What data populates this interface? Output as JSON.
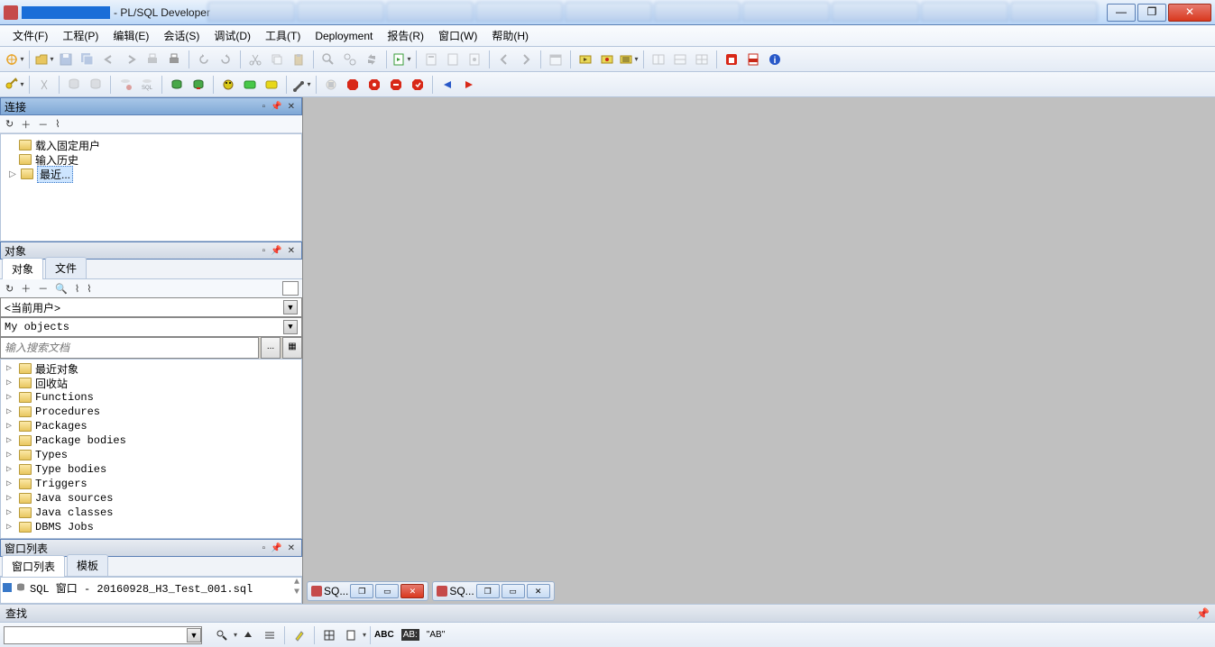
{
  "title": "- PL/SQL Developer",
  "menu": [
    "文件(F)",
    "工程(P)",
    "编辑(E)",
    "会话(S)",
    "调试(D)",
    "工具(T)",
    "Deployment",
    "报告(R)",
    "窗口(W)",
    "帮助(H)"
  ],
  "panels": {
    "connections": {
      "title": "连接"
    },
    "objects": {
      "title": "对象"
    },
    "winlist": {
      "title": "窗口列表"
    }
  },
  "conn_tree": [
    {
      "label": "载入固定用户",
      "exp": false
    },
    {
      "label": "输入历史",
      "exp": false
    },
    {
      "label": "最近...",
      "exp": true,
      "selected": true
    }
  ],
  "obj_tabs": [
    "对象",
    "文件"
  ],
  "obj_user": "<当前用户>",
  "obj_filter": "My objects",
  "obj_search_placeholder": "输入搜索文档",
  "obj_tree": [
    "最近对象",
    "回收站",
    "Functions",
    "Procedures",
    "Packages",
    "Package bodies",
    "Types",
    "Type bodies",
    "Triggers",
    "Java sources",
    "Java classes",
    "DBMS Jobs"
  ],
  "winlist_tabs": [
    "窗口列表",
    "模板"
  ],
  "winlist_item": "SQL 窗口 - 20160928_H3_Test_001.sql",
  "find_label": "查找",
  "mdi_tabs": [
    "SQ...",
    "SQ..."
  ],
  "bottom_labels": {
    "abc": "ABC",
    "ab_quoted": "\"AB\""
  }
}
